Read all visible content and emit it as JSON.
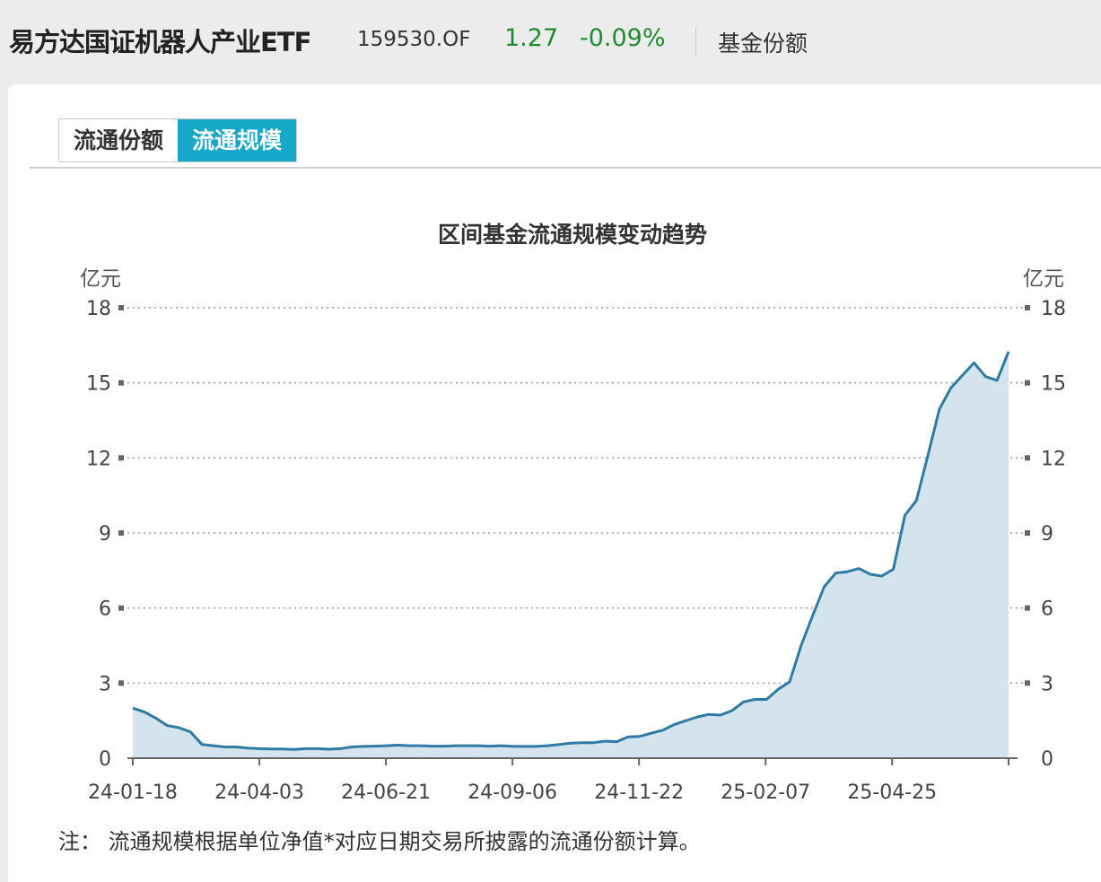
{
  "header": {
    "fund_name": "易方达国证机器人产业ETF",
    "fund_code": "159530.OF",
    "price": "1.27",
    "change": "-0.09%",
    "shares_link": "基金份额"
  },
  "tabs": [
    {
      "label": "流通份额",
      "active": false
    },
    {
      "label": "流通规模",
      "active": true
    }
  ],
  "colors": {
    "accent": "#17a7c9",
    "positive_green": "#1f8a2e",
    "line": "#2e7ba3",
    "area": "#d4e4ee"
  },
  "note": "注：  流通规模根据单位净值*对应日期交易所披露的流通份额计算。",
  "chart_data": {
    "type": "area",
    "title": "区间基金流通规模变动趋势",
    "y_unit_left": "亿元",
    "y_unit_right": "亿元",
    "ylim": [
      0,
      18
    ],
    "yticks": [
      0,
      3,
      6,
      9,
      12,
      15,
      18
    ],
    "grid": "horizontal-dotted",
    "x_tick_labels": [
      "24-01-18",
      "24-04-03",
      "24-06-21",
      "24-09-06",
      "24-11-22",
      "25-02-07",
      "25-04-25"
    ],
    "series": [
      {
        "values": [
          2.0,
          1.85,
          1.6,
          1.3,
          1.22,
          1.05,
          0.55,
          0.5,
          0.45,
          0.45,
          0.4,
          0.38,
          0.37,
          0.37,
          0.35,
          0.38,
          0.38,
          0.36,
          0.38,
          0.45,
          0.47,
          0.48,
          0.5,
          0.52,
          0.5,
          0.5,
          0.48,
          0.48,
          0.5,
          0.5,
          0.5,
          0.48,
          0.5,
          0.47,
          0.47,
          0.47,
          0.5,
          0.55,
          0.6,
          0.62,
          0.62,
          0.68,
          0.66,
          0.85,
          0.87,
          1.0,
          1.12,
          1.35,
          1.5,
          1.65,
          1.75,
          1.72,
          1.9,
          2.25,
          2.35,
          2.35,
          2.75,
          3.05,
          4.5,
          5.7,
          6.85,
          7.4,
          7.45,
          7.58,
          7.35,
          7.28,
          7.55,
          9.7,
          10.3,
          12.1,
          13.95,
          14.8,
          15.3,
          15.8,
          15.25,
          15.1,
          16.25
        ]
      }
    ]
  }
}
